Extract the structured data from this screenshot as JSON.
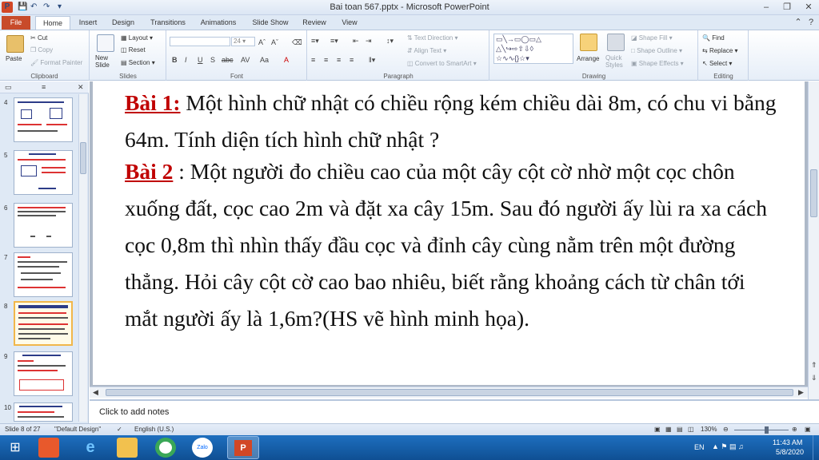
{
  "window": {
    "title": "Bai toan 567.pptx - Microsoft PowerPoint",
    "app_icon": "P",
    "quick_access": [
      "save-icon",
      "undo-icon",
      "redo-icon",
      "customize-icon"
    ]
  },
  "tabs": {
    "file": "File",
    "items": [
      "Home",
      "Insert",
      "Design",
      "Transitions",
      "Animations",
      "Slide Show",
      "Review",
      "View"
    ],
    "active": "Home"
  },
  "ribbon": {
    "clipboard": {
      "label": "Clipboard",
      "paste": "Paste",
      "cut": "Cut",
      "copy": "Copy",
      "format_painter": "Format Painter"
    },
    "slides": {
      "label": "Slides",
      "new_slide": "New\nSlide",
      "layout": "Layout",
      "reset": "Reset",
      "section": "Section"
    },
    "font": {
      "label": "Font",
      "font_name": "",
      "font_size": "24",
      "bold": "B",
      "italic": "I",
      "underline": "U",
      "shadow": "S",
      "strike": "abc",
      "spacing": "AV",
      "case": "Aa",
      "color": "A"
    },
    "paragraph": {
      "label": "Paragraph",
      "text_direction": "Text Direction",
      "align_text": "Align Text",
      "convert": "Convert to SmartArt"
    },
    "drawing": {
      "label": "Drawing",
      "arrange": "Arrange",
      "quick_styles": "Quick\nStyles",
      "shape_fill": "Shape Fill",
      "shape_outline": "Shape Outline",
      "shape_effects": "Shape Effects"
    },
    "editing": {
      "label": "Editing",
      "find": "Find",
      "replace": "Replace",
      "select": "Select"
    }
  },
  "slide_panel": {
    "thumbnails": [
      {
        "num": "4"
      },
      {
        "num": "5"
      },
      {
        "num": "6"
      },
      {
        "num": "7"
      },
      {
        "num": "8",
        "selected": true
      },
      {
        "num": "9"
      },
      {
        "num": "10"
      }
    ]
  },
  "slide": {
    "bai1_label": "Bài 1:",
    "bai1_text": " Một hình chữ nhật có chiều rộng kém chiều dài 8m, có chu vi bằng 64m. Tính diện tích hình chữ nhật ?",
    "bai2_label": "Bài 2",
    "bai2_text": " : Một người đo chiều cao của một cây cột cờ nhờ một cọc chôn xuống đất, cọc cao 2m  và đặt  xa cây 15m. Sau đó người ấy lùi ra xa cách cọc 0,8m thì nhìn thấy đầu cọc và đỉnh cây cùng nằm trên một đường thẳng. Hỏi cây cột cờ cao bao nhiêu, biết rằng khoảng cách từ chân tới mắt người ấy là 1,6m?(HS vẽ hình minh họa)."
  },
  "notes": {
    "placeholder": "Click to add notes"
  },
  "status": {
    "slide_info": "Slide 8 of 27",
    "theme": "\"Default Design\"",
    "language": "English (U.S.)",
    "zoom": "130%"
  },
  "taskbar": {
    "apps": [
      "start-icon",
      "office-icon",
      "ie-icon",
      "explorer-icon",
      "chrome-icon",
      "zalo-icon",
      "powerpoint-icon"
    ],
    "zalo_label": "Zalo",
    "lang": "EN",
    "time": "11:43 AM",
    "date": "5/8/2020"
  },
  "colors": {
    "accent": "#c84b2a",
    "title_red": "#c00000",
    "taskbar": "#1e6fbf"
  }
}
